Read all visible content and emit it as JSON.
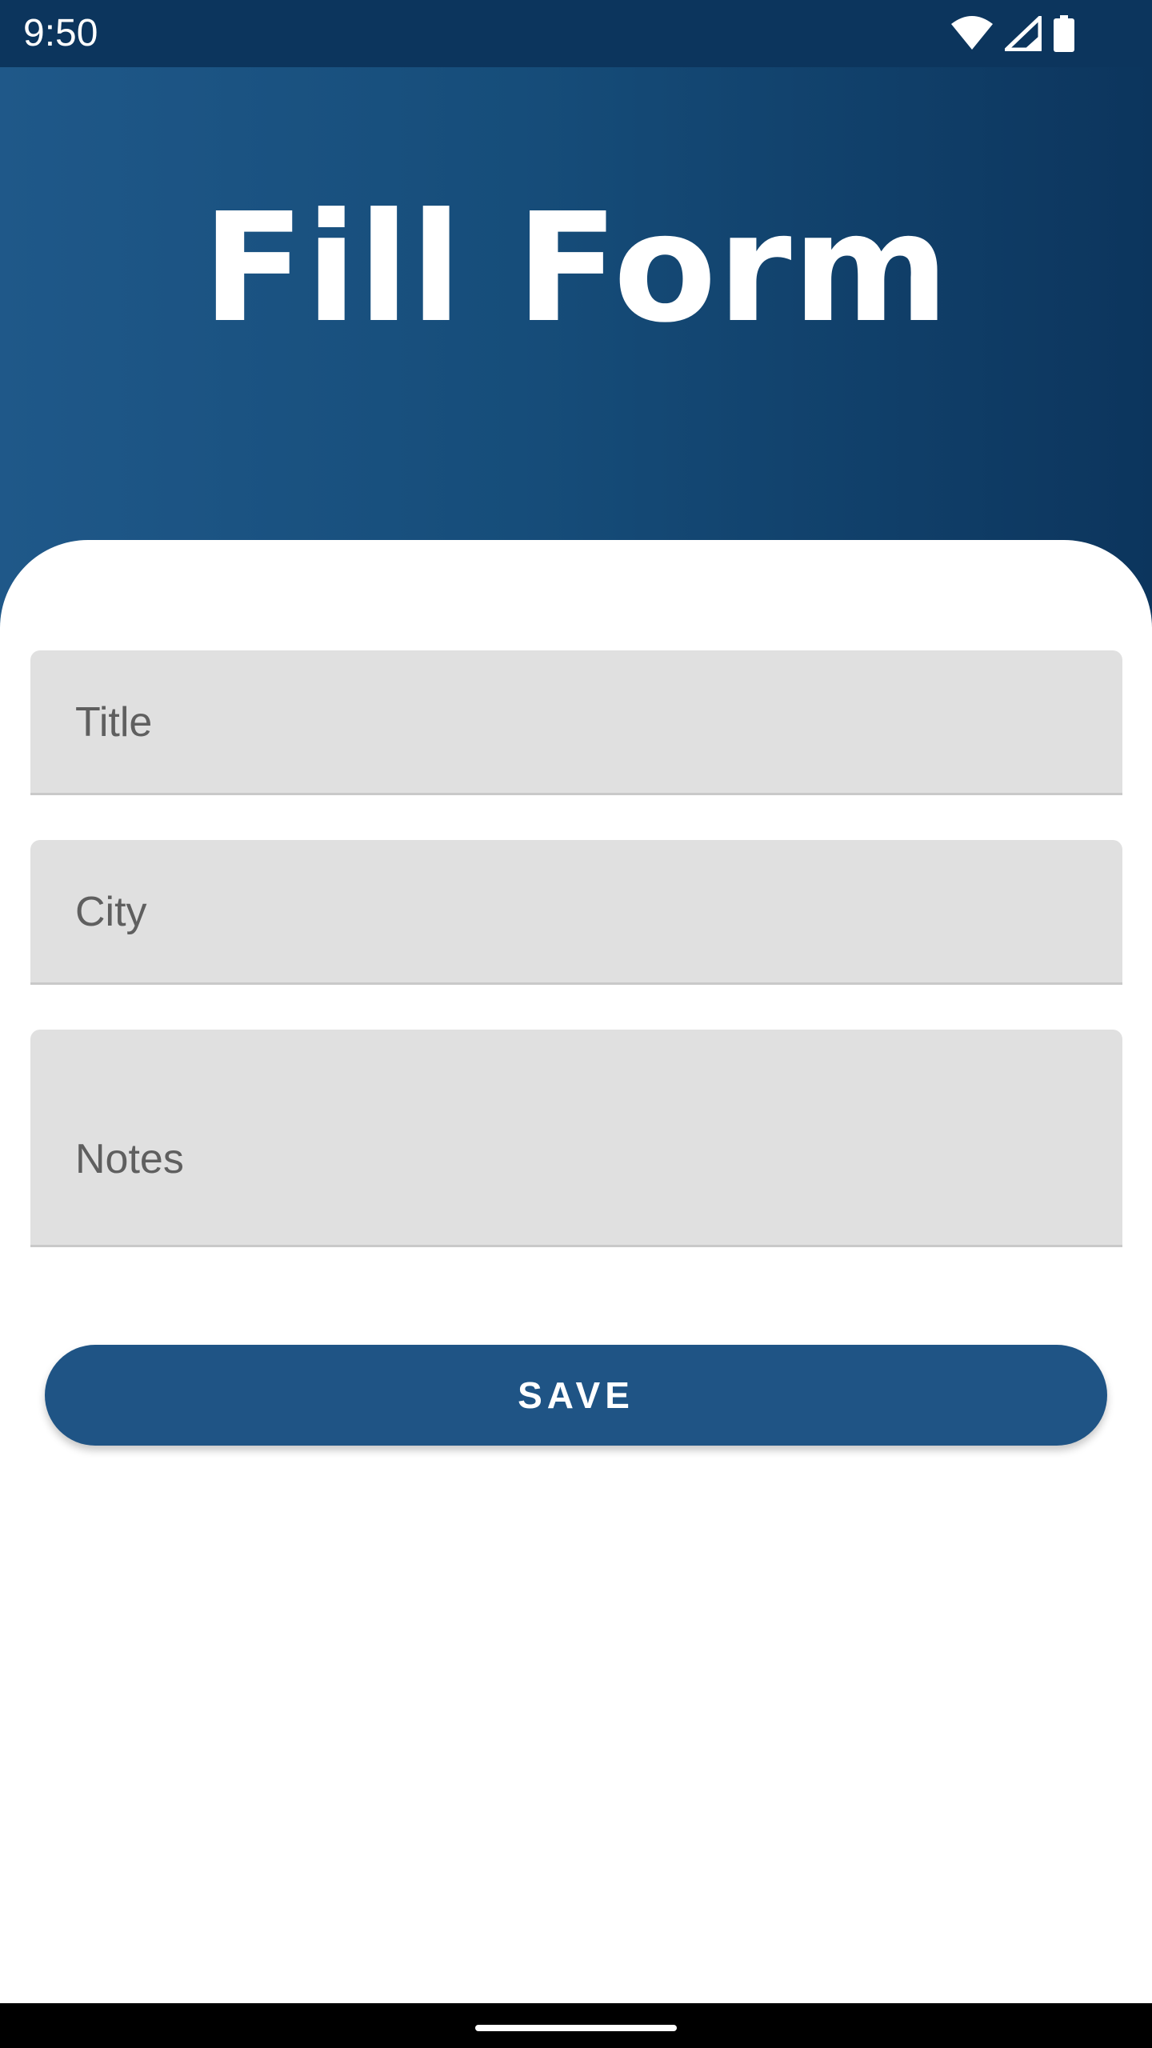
{
  "status_bar": {
    "time": "9:50",
    "icons": [
      "wifi-icon",
      "cellular-signal-icon",
      "battery-icon"
    ]
  },
  "header": {
    "title": "Fill Form"
  },
  "form": {
    "fields": [
      {
        "placeholder": "Title",
        "value": ""
      },
      {
        "placeholder": "City",
        "value": ""
      },
      {
        "placeholder": "Notes",
        "value": ""
      }
    ],
    "save_label": "SAVE"
  },
  "colors": {
    "header_gradient_start": "#1f5889",
    "header_gradient_end": "#0c355d",
    "status_bar": "#0c355d",
    "field_background": "#e0e0e0",
    "button": "#1f5485",
    "label_text": "#5f5f5f"
  }
}
